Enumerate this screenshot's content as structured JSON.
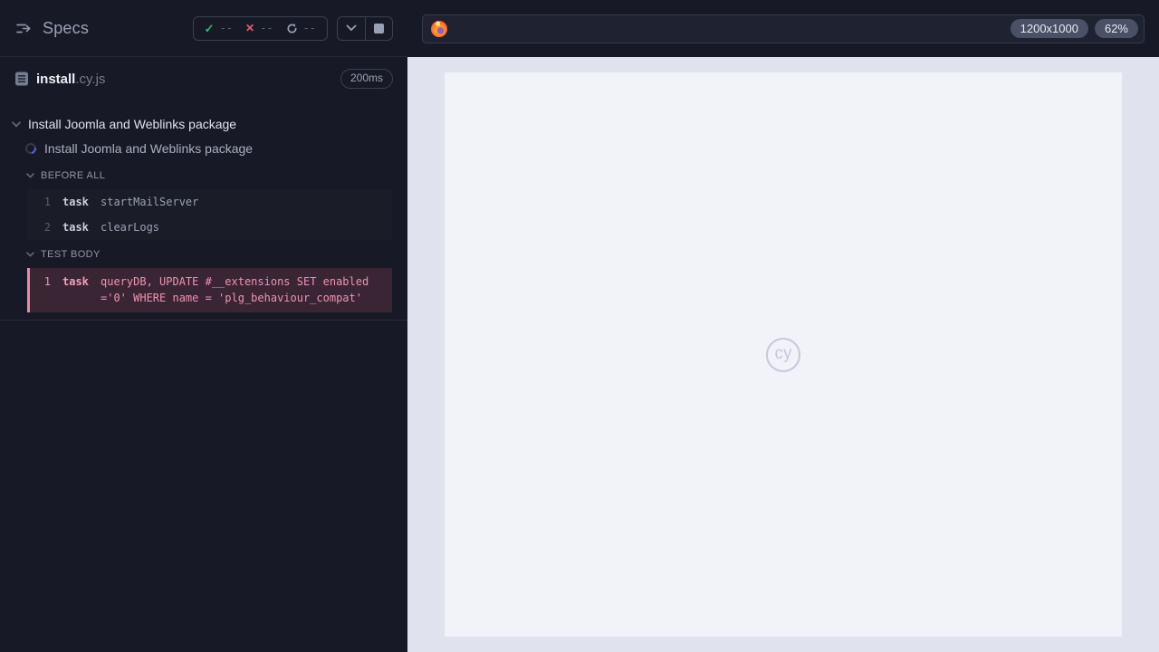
{
  "reporter": {
    "header": {
      "title": "Specs",
      "stats": {
        "passed": "--",
        "failed": "--",
        "pending": "--"
      }
    },
    "spec": {
      "name": "install",
      "extension": ".cy.js",
      "duration": "200ms"
    },
    "suite_title": "Install Joomla and Weblinks package",
    "test_title": "Install Joomla and Weblinks package",
    "sections": [
      {
        "label": "BEFORE ALL",
        "commands": [
          {
            "number": "1",
            "method": "task",
            "message": "startMailServer"
          },
          {
            "number": "2",
            "method": "task",
            "message": "clearLogs"
          }
        ]
      },
      {
        "label": "TEST BODY",
        "commands": [
          {
            "number": "1",
            "method": "task",
            "message": "queryDB, UPDATE #__extensions SET enabled ='0' WHERE name = 'plg_behaviour_compat'"
          }
        ]
      }
    ]
  },
  "runner": {
    "url": "",
    "browser": "firefox",
    "viewport_size": "1200x1000",
    "viewport_scale": "62%",
    "watermark": "cy"
  },
  "colors": {
    "reporter_bg": "#171a26",
    "command_bg": "#1a1d28",
    "failed_bg": "#3a2535",
    "failed_accent": "#e88da6",
    "passed_green": "#31b573",
    "failed_red": "#e45f6e",
    "running_blue": "#5a66dd",
    "stage_bg": "#e0e3ed",
    "viewport_bg": "#f2f3f9"
  }
}
